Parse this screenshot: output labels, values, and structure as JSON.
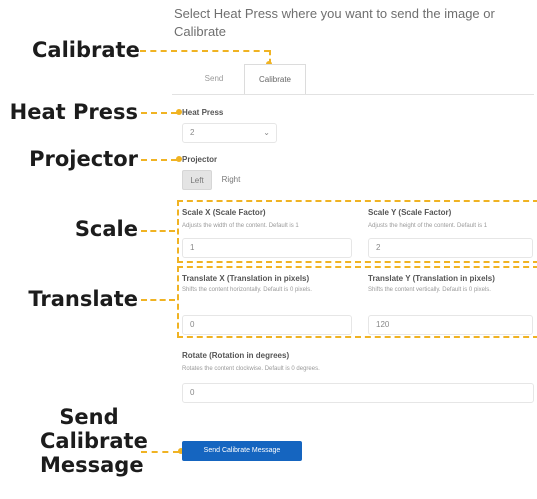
{
  "header": {
    "instruction": "Select Heat Press where you want to send the image or Calibrate"
  },
  "tabs": [
    {
      "label": "Send"
    },
    {
      "label": "Calibrate",
      "active": true
    }
  ],
  "heat_press": {
    "label": "Heat Press",
    "value": "2"
  },
  "projector": {
    "label": "Projector",
    "options": [
      "Left",
      "Right"
    ],
    "selected": "Left"
  },
  "scale_x": {
    "label": "Scale X (Scale Factor)",
    "help": "Adjusts the width of the content. Default is 1",
    "value": "1"
  },
  "scale_y": {
    "label": "Scale Y (Scale Factor)",
    "help": "Adjusts the height of the content. Default is 1",
    "value": "2"
  },
  "translate_x": {
    "label": "Translate X (Translation in pixels)",
    "help": "Shifts the content horizontally. Default is 0 pixels.",
    "value": "0"
  },
  "translate_y": {
    "label": "Translate Y (Translation in pixels)",
    "help": "Shifts the content vertically. Default is 0 pixels.",
    "value": "120"
  },
  "rotate": {
    "label": "Rotate (Rotation in degrees)",
    "help": "Rotates the content clockwise. Default is 0 degrees.",
    "value": "0"
  },
  "send_button": {
    "label": "Send Calibrate Message"
  },
  "callouts": {
    "calibrate": "Calibrate",
    "heat_press": "Heat Press",
    "projector": "Projector",
    "scale": "Scale",
    "translate": "Translate",
    "send_line1": "Send",
    "send_line2": "Calibrate",
    "send_line3": "Message"
  },
  "colors": {
    "annotation": "#f0b323",
    "button": "#1565c0"
  }
}
